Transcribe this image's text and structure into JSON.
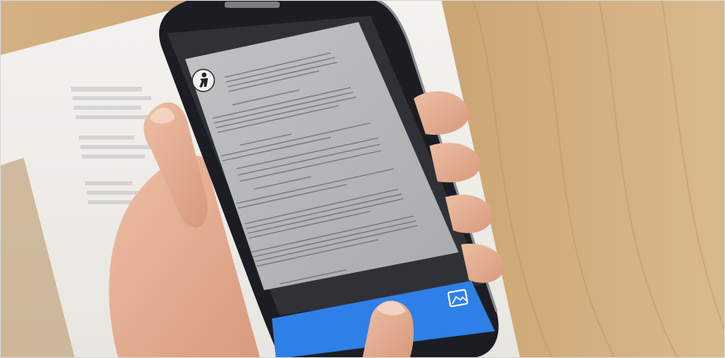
{
  "scene": {
    "background_color": "#c9a574",
    "phone_body_color": "#1c1d22",
    "screen_dark_color": "#2f3136",
    "doc_paper_color": "#b7b9bc",
    "app_bar_color": "#2f7fe8",
    "skin_color": "#e2a98d"
  },
  "icons": {
    "doc_logo": "figure-icon",
    "gallery": "image-gallery-icon"
  }
}
